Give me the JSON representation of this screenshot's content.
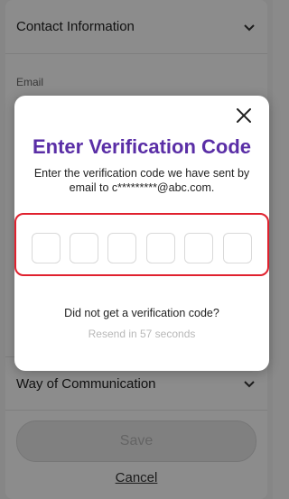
{
  "background": {
    "contact_section_title": "Contact Information",
    "email_label": "Email",
    "way_section_title": "Way of Communication",
    "save_label": "Save",
    "cancel_label": "Cancel"
  },
  "modal": {
    "title": "Enter Verification Code",
    "message": "Enter the verification code we have sent by email to c*********@abc.com.",
    "code_length": 6,
    "resend_question": "Did not get a verification code?",
    "resend_timer": "Resend in 57 seconds"
  },
  "colors": {
    "title": "#5a2ea6",
    "highlight_border": "#e0212e",
    "disabled_text": "#b8b8b8"
  }
}
